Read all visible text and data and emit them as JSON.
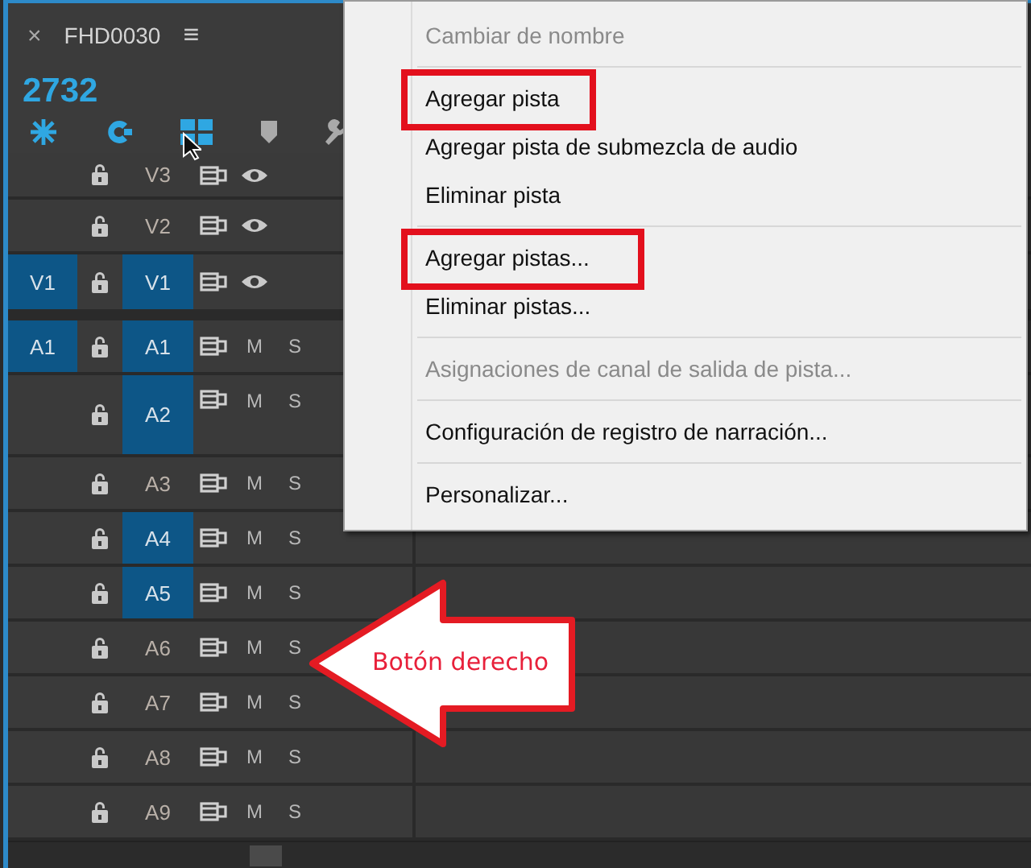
{
  "panel": {
    "close": "×",
    "title": "FHD0030",
    "menu": "≡",
    "timecode": "2732"
  },
  "tracks": [
    {
      "kind": "video",
      "name": "V3",
      "targeted": false,
      "expanded": false
    },
    {
      "kind": "video",
      "name": "V2",
      "targeted": false,
      "expanded": false
    },
    {
      "kind": "video",
      "name": "V1",
      "source": "V1",
      "targeted": true,
      "expanded": false
    },
    {
      "kind": "audio",
      "name": "A1",
      "source": "A1",
      "targeted": true,
      "expanded": false,
      "mute": "M",
      "solo": "S"
    },
    {
      "kind": "audio",
      "name": "A2",
      "targeted": true,
      "expanded": true,
      "mute": "M",
      "solo": "S"
    },
    {
      "kind": "audio",
      "name": "A3",
      "targeted": false,
      "expanded": false,
      "mute": "M",
      "solo": "S"
    },
    {
      "kind": "audio",
      "name": "A4",
      "targeted": true,
      "expanded": false,
      "mute": "M",
      "solo": "S"
    },
    {
      "kind": "audio",
      "name": "A5",
      "targeted": true,
      "expanded": false,
      "mute": "M",
      "solo": "S"
    },
    {
      "kind": "audio",
      "name": "A6",
      "targeted": false,
      "expanded": false,
      "mute": "M",
      "solo": "S"
    },
    {
      "kind": "audio",
      "name": "A7",
      "targeted": false,
      "expanded": false,
      "mute": "M",
      "solo": "S"
    },
    {
      "kind": "audio",
      "name": "A8",
      "targeted": false,
      "expanded": false,
      "mute": "M",
      "solo": "S"
    },
    {
      "kind": "audio",
      "name": "A9",
      "targeted": false,
      "expanded": false,
      "mute": "M",
      "solo": "S"
    }
  ],
  "context_menu": {
    "sections": [
      [
        {
          "label": "Cambiar de nombre",
          "disabled": true,
          "highlighted": false
        }
      ],
      [
        {
          "label": "Agregar pista",
          "disabled": false,
          "highlighted": true
        },
        {
          "label": "Agregar pista de submezcla de audio",
          "disabled": false,
          "highlighted": false
        },
        {
          "label": "Eliminar pista",
          "disabled": false,
          "highlighted": false
        }
      ],
      [
        {
          "label": "Agregar pistas...",
          "disabled": false,
          "highlighted": true
        },
        {
          "label": "Eliminar pistas...",
          "disabled": false,
          "highlighted": false
        }
      ],
      [
        {
          "label": "Asignaciones de canal de salida de pista...",
          "disabled": true,
          "highlighted": false
        }
      ],
      [
        {
          "label": "Configuración de registro de narración...",
          "disabled": false,
          "highlighted": false
        }
      ],
      [
        {
          "label": "Personalizar...",
          "disabled": false,
          "highlighted": false
        }
      ]
    ]
  },
  "callout": {
    "text": "Botón derecho"
  }
}
